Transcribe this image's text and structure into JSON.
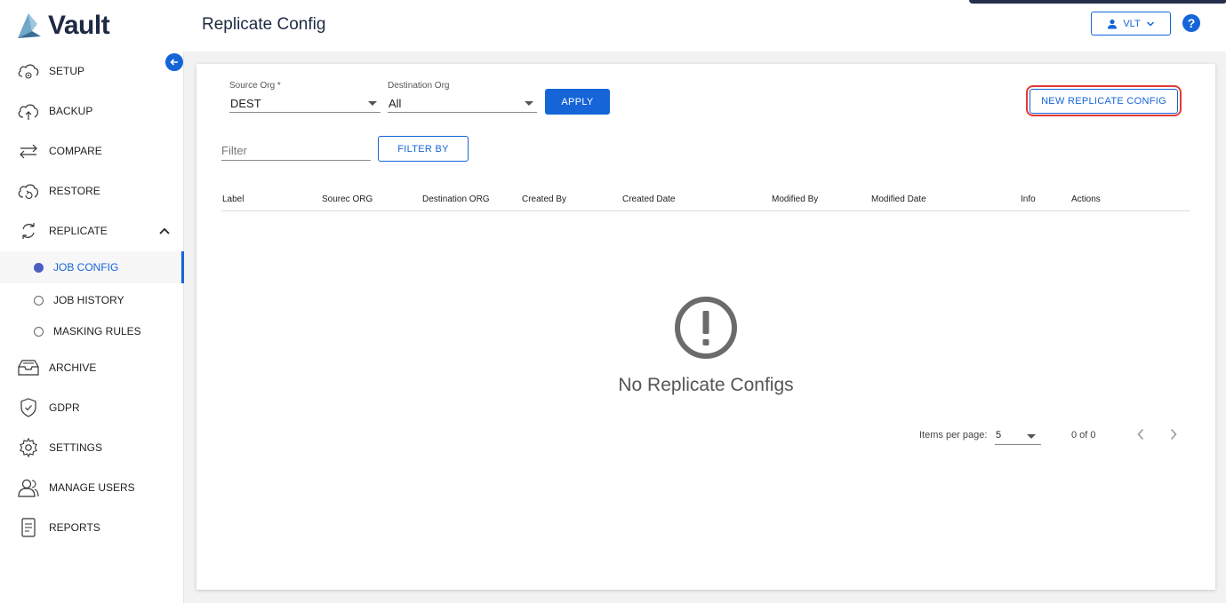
{
  "app": {
    "brand": "Vault",
    "page_title": "Replicate Config"
  },
  "user": {
    "name": "VLT"
  },
  "sidebar": {
    "items": [
      {
        "label": "SETUP",
        "icon": "cloud-gear-icon"
      },
      {
        "label": "BACKUP",
        "icon": "cloud-upload-icon"
      },
      {
        "label": "COMPARE",
        "icon": "arrows-compare-icon"
      },
      {
        "label": "RESTORE",
        "icon": "cloud-restore-icon"
      },
      {
        "label": "REPLICATE",
        "icon": "replicate-icon"
      },
      {
        "label": "ARCHIVE",
        "icon": "archive-box-icon"
      },
      {
        "label": "GDPR",
        "icon": "shield-check-icon"
      },
      {
        "label": "SETTINGS",
        "icon": "gear-icon"
      },
      {
        "label": "MANAGE USERS",
        "icon": "users-icon"
      },
      {
        "label": "REPORTS",
        "icon": "document-icon"
      }
    ],
    "replicate_children": [
      {
        "label": "JOB CONFIG",
        "active": true
      },
      {
        "label": "JOB HISTORY",
        "active": false
      },
      {
        "label": "MASKING RULES",
        "active": false
      }
    ]
  },
  "filters": {
    "source_org_label": "Source Org *",
    "source_org_value": "DEST",
    "destination_org_label": "Destination Org",
    "destination_org_value": "All",
    "apply_label": "APPLY",
    "new_config_label": "NEW REPLICATE CONFIG",
    "filter_placeholder": "Filter",
    "filter_by_label": "FILTER BY"
  },
  "table": {
    "columns": [
      "Label",
      "Sourec ORG",
      "Destination ORG",
      "Created By",
      "Created Date",
      "Modified By",
      "Modified Date",
      "Info",
      "Actions"
    ]
  },
  "empty_state": {
    "message": "No Replicate Configs",
    "icon": "exclamation-circle-icon"
  },
  "pagination": {
    "items_per_page_label": "Items per page:",
    "items_per_page": "5",
    "range": "0 of 0"
  },
  "colors": {
    "accent": "#1565d8",
    "highlight": "#e53935",
    "brand_text": "#1e2a44"
  }
}
